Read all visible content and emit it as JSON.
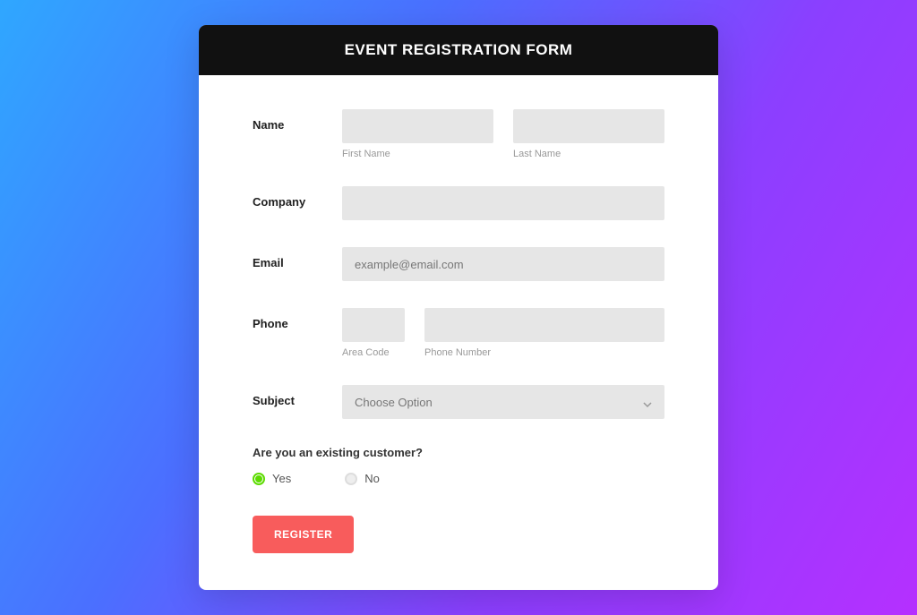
{
  "header": {
    "title": "EVENT REGISTRATION FORM"
  },
  "fields": {
    "name": {
      "label": "Name",
      "first": {
        "value": "",
        "sublabel": "First Name"
      },
      "last": {
        "value": "",
        "sublabel": "Last Name"
      }
    },
    "company": {
      "label": "Company",
      "value": ""
    },
    "email": {
      "label": "Email",
      "placeholder": "example@email.com",
      "value": ""
    },
    "phone": {
      "label": "Phone",
      "area": {
        "value": "",
        "sublabel": "Area Code"
      },
      "number": {
        "value": "",
        "sublabel": "Phone Number"
      }
    },
    "subject": {
      "label": "Subject",
      "selected": "Choose Option"
    },
    "existing_customer": {
      "question": "Are you an existing customer?",
      "options": {
        "yes": "Yes",
        "no": "No"
      },
      "selected": "yes"
    }
  },
  "actions": {
    "register": "REGISTER"
  }
}
